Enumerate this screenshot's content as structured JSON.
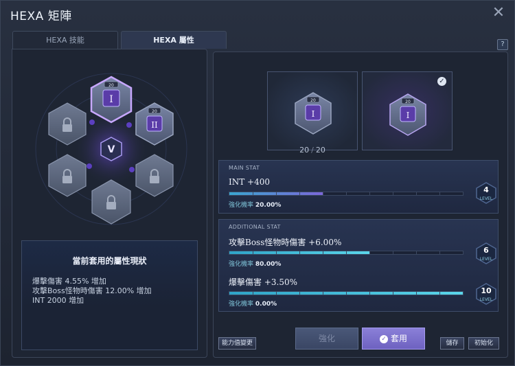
{
  "window": {
    "title": "HEXA 矩陣",
    "help_label": "?"
  },
  "tabs": [
    {
      "label": "HEXA 技能",
      "active": false
    },
    {
      "label": "HEXA 屬性",
      "active": true
    }
  ],
  "hex_grid": {
    "nodes": [
      {
        "name": "node-top",
        "level": "20",
        "numeral": "I",
        "locked": false,
        "selected": true
      },
      {
        "name": "node-upper-right",
        "level": "20",
        "numeral": "II",
        "locked": false,
        "selected": false
      },
      {
        "name": "node-upper-left",
        "locked": true
      },
      {
        "name": "node-lower-left",
        "locked": true
      },
      {
        "name": "node-lower-right",
        "locked": true
      },
      {
        "name": "node-bottom",
        "locked": true
      }
    ]
  },
  "status": {
    "heading": "當前套用的屬性現狀",
    "lines": [
      "爆擊傷害 4.55% 增加",
      "攻擊Boss怪物時傷害 12.00% 增加",
      "INT 2000 增加"
    ]
  },
  "preview": {
    "current_level": "20",
    "current_numeral": "I",
    "current_count": "20",
    "max_count": "20",
    "count_sep": "/",
    "next_level": "20",
    "next_numeral": "I"
  },
  "main_stat": {
    "label": "MAIN STAT",
    "name": "INT +400",
    "rate_label": "強化機率",
    "rate": "20.00%",
    "level": "4",
    "level_label": "LEVEL",
    "progress": 0.4
  },
  "additional_stat": {
    "label": "ADDITIONAL STAT",
    "items": [
      {
        "name": "攻擊Boss怪物時傷害 +6.00%",
        "rate_label": "強化機率",
        "rate": "80.00%",
        "level": "6",
        "level_label": "LEVEL",
        "progress": 0.6
      },
      {
        "name": "爆擊傷害 +3.50%",
        "rate_label": "強化機率",
        "rate": "0.00%",
        "level": "10",
        "level_label": "LEVEL",
        "progress": 1.0
      }
    ]
  },
  "buttons": {
    "reset_ability": "能力值變更",
    "enhance": "強化",
    "apply": "套用",
    "save": "儲存",
    "initialize": "初始化"
  },
  "colors": {
    "accent": "#7b67d8",
    "bar": "#3fc0dc",
    "apply": "#7a70d0"
  }
}
